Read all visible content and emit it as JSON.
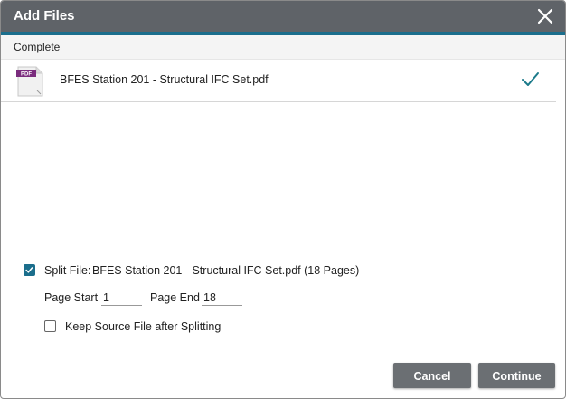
{
  "dialog": {
    "title": "Add Files",
    "close_icon": "close-icon"
  },
  "status": {
    "text": "Complete"
  },
  "file": {
    "icon": "pdf-file-icon",
    "icon_label": "PDF",
    "name": "BFES Station 201 - Structural IFC Set.pdf",
    "status_icon": "checkmark-icon"
  },
  "split": {
    "checked": true,
    "label": "Split File:",
    "detail": "BFES Station 201 - Structural IFC Set.pdf (18 Pages)",
    "page_start_label": "Page Start",
    "page_start_value": "1",
    "page_end_label": "Page End",
    "page_end_value": "18",
    "keep_source_checked": false,
    "keep_source_label": "Keep Source File after Splitting"
  },
  "buttons": {
    "cancel": "Cancel",
    "continue": "Continue"
  },
  "colors": {
    "titlebar": "#5f6368",
    "accent": "#1b6e8c",
    "pdf_brand": "#7a2c7d",
    "check": "#1b7a8a",
    "button": "#6b6f73"
  }
}
